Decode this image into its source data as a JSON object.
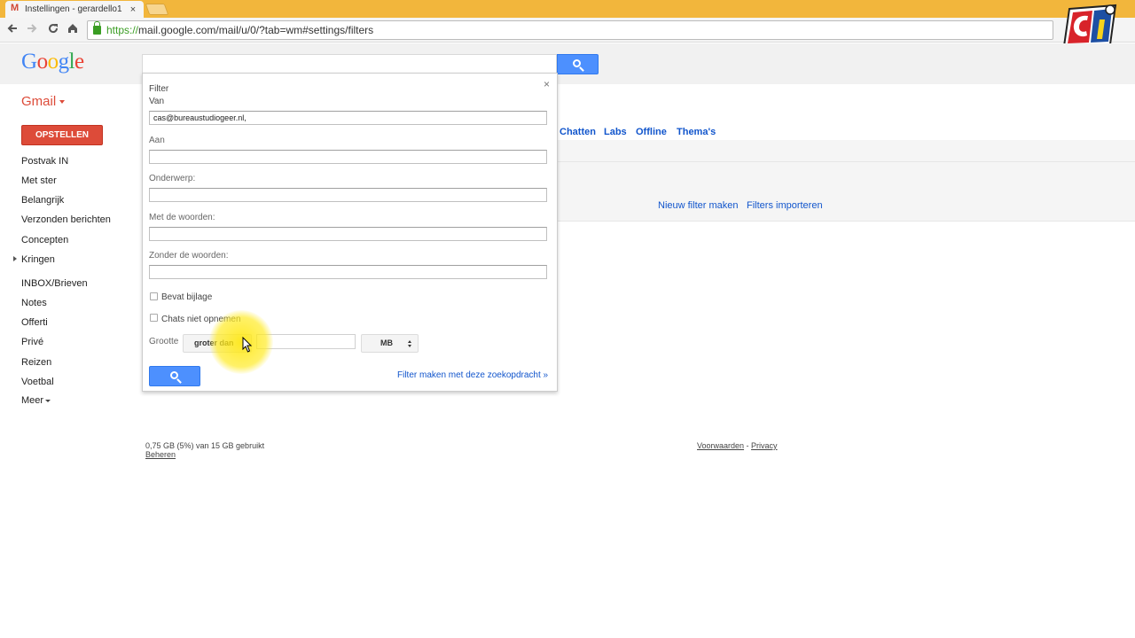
{
  "browser": {
    "tab_title": "Instellingen - gerardello1",
    "tab_close": "×",
    "url_scheme": "https://",
    "url_rest": "mail.google.com/mail/u/0/?tab=wm#settings/filters"
  },
  "header": {
    "logo_letters": [
      "G",
      "o",
      "o",
      "g",
      "l",
      "e"
    ],
    "logo_colors": [
      "#4285f4",
      "#ea4335",
      "#fbbc05",
      "#4285f4",
      "#34a853",
      "#ea4335"
    ]
  },
  "gmail_label": "Gmail",
  "compose_label": "OPSTELLEN",
  "nav": {
    "items": [
      "Postvak IN",
      "Met ster",
      "Belangrijk",
      "Verzonden berichten",
      "Concepten",
      "Kringen",
      "INBOX/Brieven",
      "Notes",
      "Offerti",
      "Privé",
      "Reizen",
      "Voetbal"
    ],
    "more": "Meer"
  },
  "settings_tabs": [
    "Chatten",
    "Labs",
    "Offline",
    "Thema's"
  ],
  "filter_links": {
    "new_filter": "Nieuw filter maken",
    "import": "Filters importeren"
  },
  "filter_dialog": {
    "close": "×",
    "title": "Filter",
    "from_label": "Van",
    "from_value": "cas@bureaustudiogeer.nl,",
    "to_label": "Aan",
    "subject_label": "Onderwerp:",
    "has_words_label": "Met de woorden:",
    "without_words_label": "Zonder de woorden:",
    "has_attachment_label": "Bevat bijlage",
    "no_chats_label": "Chats niet opnemen",
    "size_label": "Grootte",
    "size_operator": "groter dan",
    "size_unit": "MB",
    "create_filter_link": "Filter maken met deze zoekopdracht »"
  },
  "footer": {
    "usage": "0,75 GB (5%) van 15 GB gebruikt",
    "manage": "Beheren",
    "terms": "Voorwaarden",
    "separator": " - ",
    "privacy": "Privacy"
  },
  "colors": {
    "accent_red": "#dd4b39",
    "accent_blue": "#4d90fe",
    "link_blue": "#1155cc"
  }
}
